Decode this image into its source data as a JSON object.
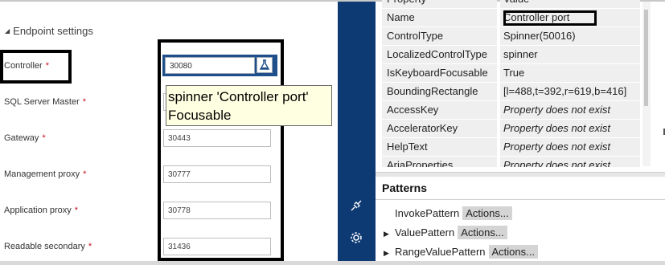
{
  "left_panel": {
    "section_title": "Endpoint settings",
    "required_marker": "*",
    "fields": [
      {
        "label": "Controller",
        "value": "30080"
      },
      {
        "label": "SQL Server Master",
        "value": ""
      },
      {
        "label": "Gateway",
        "value": "30443"
      },
      {
        "label": "Management proxy",
        "value": "30777"
      },
      {
        "label": "Application proxy",
        "value": "30778"
      },
      {
        "label": "Readable secondary",
        "value": "31436"
      }
    ],
    "tooltip": {
      "line1": "spinner 'Controller port'",
      "line2": "Focusable"
    }
  },
  "properties": {
    "header": {
      "name": "Property",
      "value": "Value"
    },
    "rows": [
      {
        "name": "Name",
        "value": "Controller port"
      },
      {
        "name": "ControlType",
        "value": "Spinner(50016)"
      },
      {
        "name": "LocalizedControlType",
        "value": "spinner"
      },
      {
        "name": "IsKeyboardFocusable",
        "value": "True"
      },
      {
        "name": "BoundingRectangle",
        "value": "[l=488,t=392,r=619,b=416]"
      },
      {
        "name": "AccessKey",
        "value": "Property does not exist"
      },
      {
        "name": "AcceleratorKey",
        "value": "Property does not exist"
      },
      {
        "name": "HelpText",
        "value": "Property does not exist"
      },
      {
        "name": "AriaProperties",
        "value": "Property does not exist"
      }
    ]
  },
  "patterns": {
    "title": "Patterns",
    "items": [
      {
        "name": "InvokePattern",
        "action": "Actions..."
      },
      {
        "name": "ValuePattern",
        "action": "Actions..."
      },
      {
        "name": "RangeValuePattern",
        "action": "Actions..."
      }
    ]
  },
  "icons": {
    "flask": "flask-icon",
    "plug": "plug-icon",
    "settings": "gear-icon",
    "collapse": "triangle-down-icon",
    "expand": "triangle-right-icon"
  },
  "colors": {
    "sidebar_bg": "#0e3a73",
    "focus_border": "#1f4f8b",
    "required": "#c50f1f",
    "tooltip_bg": "#ffffe1"
  }
}
